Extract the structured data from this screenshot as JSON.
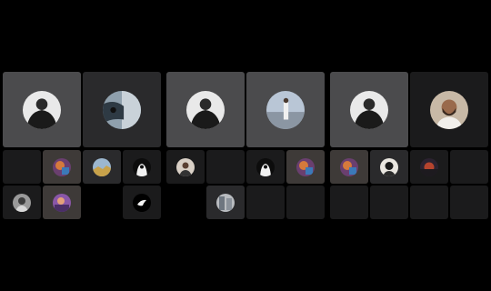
{
  "call": {
    "participant_count": 30
  },
  "colors": {
    "background": "#000000",
    "tile_light": "#4b4b4d",
    "tile_dark": "#2a2a2c",
    "tile_darker": "#1b1b1c",
    "tile_highlight": "#3e3a38"
  },
  "tiles": [
    {
      "avatar": "hooded-figure-avatar",
      "tone": "light"
    },
    {
      "avatar": "face-closeup-avatar",
      "tone": "dark"
    },
    {
      "avatar": "hooded-figure-avatar",
      "tone": "light"
    },
    {
      "avatar": "person-standing-avatar",
      "tone": "light"
    },
    {
      "avatar": "hooded-figure-avatar",
      "tone": "light"
    },
    {
      "avatar": "bearded-man-avatar",
      "tone": "darker"
    },
    {
      "avatar": "",
      "tone": "darker"
    },
    {
      "avatar": "colorful-avatar",
      "tone": "highlight"
    },
    {
      "avatar": "blue-landscape-avatar",
      "tone": "dark"
    },
    {
      "avatar": "white-headscarf-avatar",
      "tone": "darker"
    },
    {
      "avatar": "portrait-avatar",
      "tone": "darker"
    },
    {
      "avatar": "",
      "tone": "darker"
    },
    {
      "avatar": "white-headscarf-avatar",
      "tone": "darker"
    },
    {
      "avatar": "colorful-avatar",
      "tone": "highlight"
    },
    {
      "avatar": "colorful-avatar",
      "tone": "highlight"
    },
    {
      "avatar": "dark-portrait-avatar",
      "tone": "dark"
    },
    {
      "avatar": "sunset-avatar",
      "tone": "darker"
    },
    {
      "avatar": "",
      "tone": "darker"
    },
    {
      "avatar": "man-portrait-avatar",
      "tone": "darker"
    },
    {
      "avatar": "purple-avatar",
      "tone": "highlight"
    },
    {
      "avatar": "",
      "tone": "black"
    },
    {
      "avatar": "white-bird-avatar",
      "tone": "darker"
    },
    {
      "avatar": "",
      "tone": "black"
    },
    {
      "avatar": "street-avatar",
      "tone": "dark"
    },
    {
      "avatar": "",
      "tone": "darker"
    },
    {
      "avatar": "",
      "tone": "darker"
    },
    {
      "avatar": "",
      "tone": "darker"
    },
    {
      "avatar": "",
      "tone": "darker"
    },
    {
      "avatar": "",
      "tone": "darker"
    },
    {
      "avatar": "",
      "tone": "darker"
    }
  ]
}
